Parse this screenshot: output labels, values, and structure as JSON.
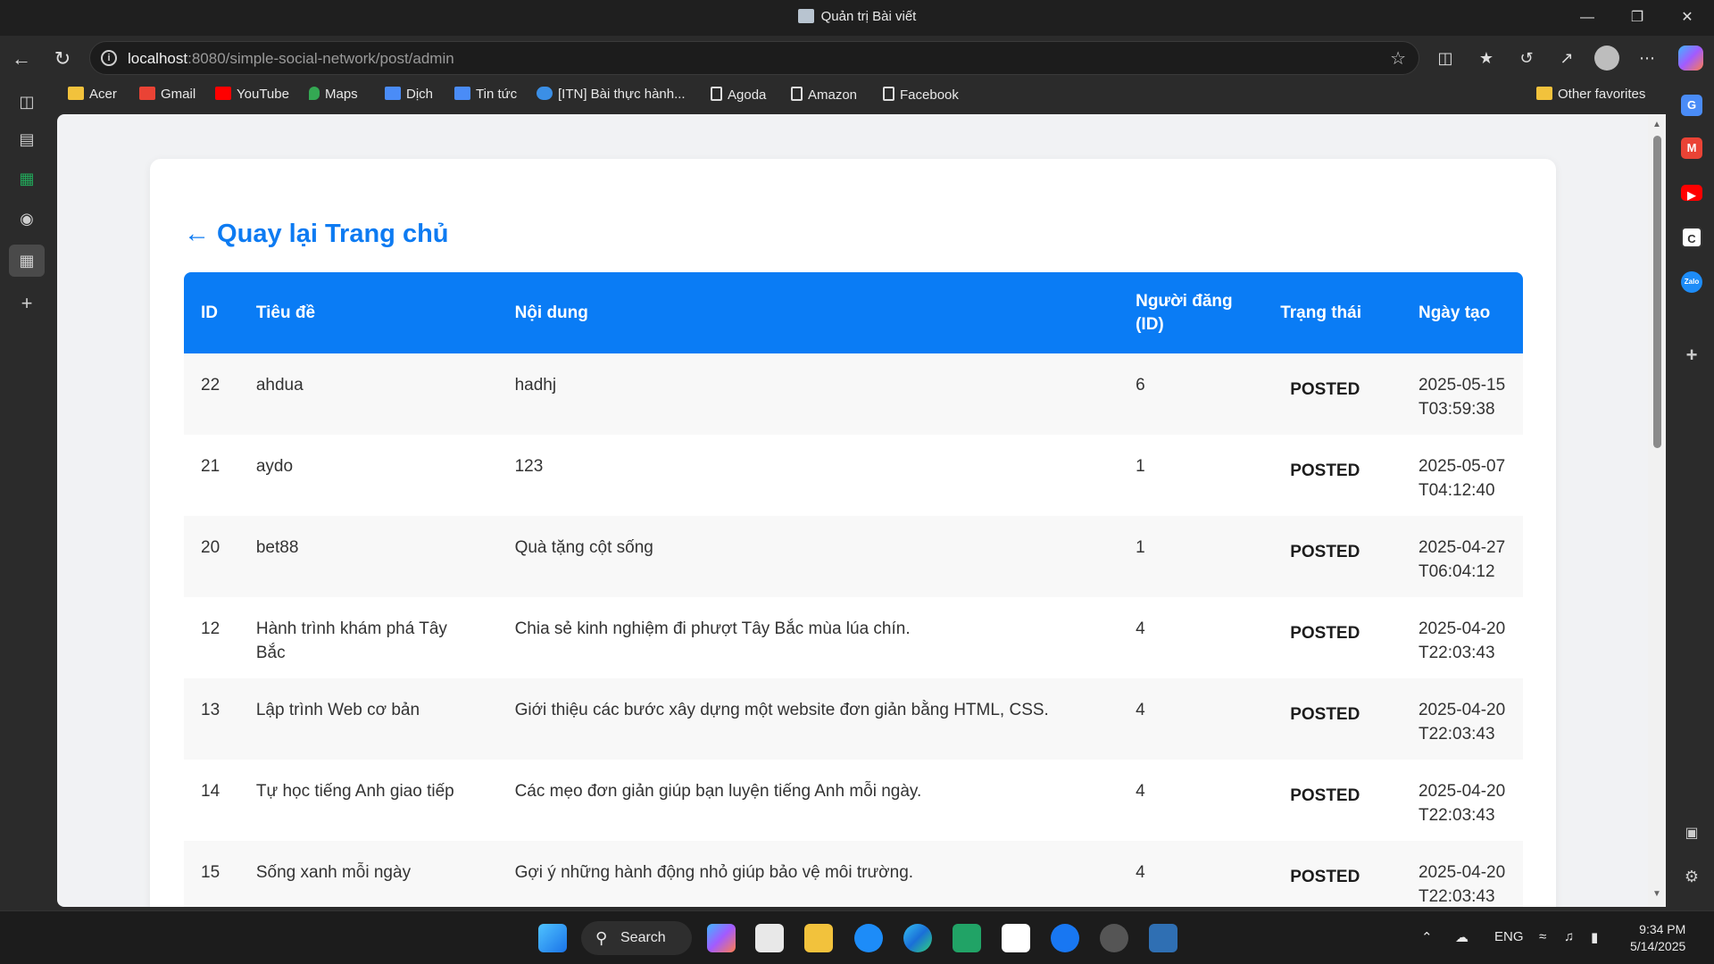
{
  "window": {
    "title": "Quản trị Bài viết"
  },
  "browser": {
    "url_host": "localhost",
    "url_rest": ":8080/simple-social-network/post/admin",
    "favorites": [
      {
        "label": "Acer",
        "icon": "folder-icon"
      },
      {
        "label": "Gmail",
        "icon": "gmail-icon"
      },
      {
        "label": "YouTube",
        "icon": "youtube-icon"
      },
      {
        "label": "Maps",
        "icon": "maps-icon"
      },
      {
        "label": "Dịch",
        "icon": "translate-icon"
      },
      {
        "label": "Tin tức",
        "icon": "news-icon"
      },
      {
        "label": "[ITN] Bài thực hành...",
        "icon": "cloud-icon"
      },
      {
        "label": "Agoda",
        "icon": "page-icon"
      },
      {
        "label": "Amazon",
        "icon": "page-icon"
      },
      {
        "label": "Facebook",
        "icon": "page-icon"
      }
    ],
    "other_favorites": "Other favorites"
  },
  "page": {
    "back_link": "← Quay lại Trang chủ",
    "table": {
      "headers": [
        "ID",
        "Tiêu đề",
        "Nội dung",
        "Người đăng (ID)",
        "Trạng thái",
        "Ngày tạo"
      ],
      "rows": [
        {
          "id": "22",
          "title": "ahdua",
          "content": "hadhj",
          "user": "6",
          "status": "POSTED",
          "created": "2025-05-15T03:59:38"
        },
        {
          "id": "21",
          "title": "aydo",
          "content": "123",
          "user": "1",
          "status": "POSTED",
          "created": "2025-05-07T04:12:40"
        },
        {
          "id": "20",
          "title": "bet88",
          "content": "Quà tặng cột sống",
          "user": "1",
          "status": "POSTED",
          "created": "2025-04-27T06:04:12"
        },
        {
          "id": "12",
          "title": "Hành trình khám phá Tây Bắc",
          "content": "Chia sẻ kinh nghiệm đi phượt Tây Bắc mùa lúa chín.",
          "user": "4",
          "status": "POSTED",
          "created": "2025-04-20T22:03:43"
        },
        {
          "id": "13",
          "title": "Lập trình Web cơ bản",
          "content": "Giới thiệu các bước xây dựng một website đơn giản bằng HTML, CSS.",
          "user": "4",
          "status": "POSTED",
          "created": "2025-04-20T22:03:43"
        },
        {
          "id": "14",
          "title": "Tự học tiếng Anh giao tiếp",
          "content": "Các mẹo đơn giản giúp bạn luyện tiếng Anh mỗi ngày.",
          "user": "4",
          "status": "POSTED",
          "created": "2025-04-20T22:03:43"
        },
        {
          "id": "15",
          "title": "Sống xanh mỗi ngày",
          "content": "Gợi ý những hành động nhỏ giúp bảo vệ môi trường.",
          "user": "4",
          "status": "POSTED",
          "created": "2025-04-20T22:03:43"
        }
      ]
    }
  },
  "taskbar": {
    "search_label": "Search",
    "language": "ENG",
    "time": "9:34 PM",
    "date": "5/14/2025"
  },
  "colors": {
    "accent": "#0a7cf5",
    "link": "#0d7bf2"
  }
}
